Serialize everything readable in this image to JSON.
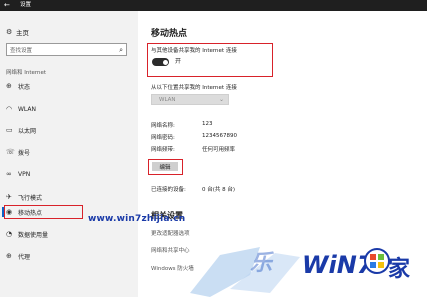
{
  "window": {
    "title": "设置",
    "back_glyph": "←"
  },
  "sidebar": {
    "home": {
      "icon": "gear-icon",
      "glyph": "⚙",
      "label": "主页"
    },
    "search": {
      "placeholder": "查找设置",
      "icon": "search-icon",
      "glyph": "⌕"
    },
    "section": "网络和 Internet",
    "items": [
      {
        "name": "status",
        "icon": "globe-icon",
        "glyph": "⊕",
        "label": "状态"
      },
      {
        "name": "wlan",
        "icon": "wifi-icon",
        "glyph": "◠",
        "label": "WLAN"
      },
      {
        "name": "ethernet",
        "icon": "ethernet-icon",
        "glyph": "▭",
        "label": "以太网"
      },
      {
        "name": "dialup",
        "icon": "phone-icon",
        "glyph": "☏",
        "label": "拨号"
      },
      {
        "name": "vpn",
        "icon": "vpn-icon",
        "glyph": "∞",
        "label": "VPN"
      },
      {
        "name": "airplane",
        "icon": "airplane-icon",
        "glyph": "✈",
        "label": "飞行模式"
      },
      {
        "name": "hotspot",
        "icon": "hotspot-icon",
        "glyph": "◉",
        "label": "移动热点",
        "active": true
      },
      {
        "name": "data-usage",
        "icon": "data-usage-icon",
        "glyph": "◔",
        "label": "数据使用量"
      },
      {
        "name": "proxy",
        "icon": "globe-proxy-icon",
        "glyph": "⊕",
        "label": "代理"
      }
    ]
  },
  "main": {
    "title": "移动热点",
    "share": {
      "label": "与其他设备共享我的 Internet 连接",
      "toggle_on": true,
      "toggle_text": "开"
    },
    "from": {
      "label": "从以下位置共享我的 Internet 连接",
      "selected": "WLAN",
      "chev": "⌄"
    },
    "details": [
      {
        "key": "网络名称:",
        "value": "123"
      },
      {
        "key": "网络密码:",
        "value": "1234567890"
      },
      {
        "key": "网络频带:",
        "value": "任何可用频率"
      }
    ],
    "edit_label": "编辑",
    "connected": {
      "key": "已连接的设备:",
      "value": "0 台(共 8 台)"
    },
    "related": {
      "title": "相关设置",
      "links": [
        "更改适配器选项",
        "网络和共享中心",
        "Windows 防火墙"
      ]
    }
  },
  "watermark": {
    "url": "www.win7zhijia.cn",
    "brand": "WIN7之家",
    "accent": "#1a3aa8"
  },
  "colors": {
    "highlight": "#d8222a",
    "sidebar_bg": "#f2f2f2",
    "titlebar_bg": "#1f1f1f"
  }
}
